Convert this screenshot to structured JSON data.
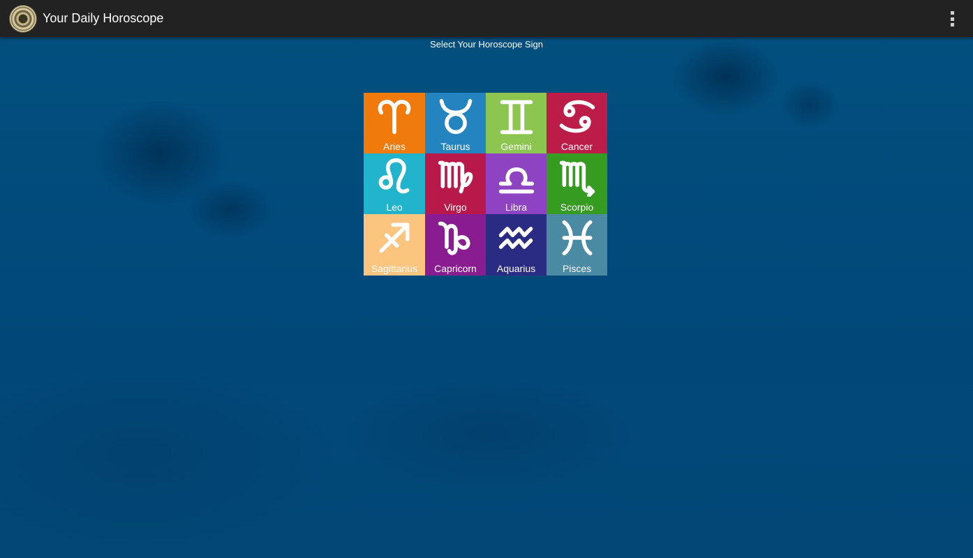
{
  "app": {
    "title": "Your Daily Horoscope",
    "icon": "zodiac-wheel-icon",
    "menu_icon": "overflow-menu-icon"
  },
  "page": {
    "subtitle": "Select Your Horoscope Sign"
  },
  "signs": [
    {
      "label": "Aries",
      "color": "#f07a0c",
      "icon": "aries-icon"
    },
    {
      "label": "Taurus",
      "color": "#2384c0",
      "icon": "taurus-icon"
    },
    {
      "label": "Gemini",
      "color": "#8cc651",
      "icon": "gemini-icon"
    },
    {
      "label": "Cancer",
      "color": "#bb1d48",
      "icon": "cancer-icon"
    },
    {
      "label": "Leo",
      "color": "#22b4cc",
      "icon": "leo-icon"
    },
    {
      "label": "Virgo",
      "color": "#b8194a",
      "icon": "virgo-icon"
    },
    {
      "label": "Libra",
      "color": "#8e44c2",
      "icon": "libra-icon"
    },
    {
      "label": "Scorpio",
      "color": "#359b21",
      "icon": "scorpio-icon"
    },
    {
      "label": "Sagittarius",
      "color": "#fcc57f",
      "icon": "sagittarius-icon"
    },
    {
      "label": "Capricorn",
      "color": "#8a1c91",
      "icon": "capricorn-icon"
    },
    {
      "label": "Aquarius",
      "color": "#2a2b82",
      "icon": "aquarius-icon"
    },
    {
      "label": "Pisces",
      "color": "#4a8aa3",
      "icon": "pisces-icon"
    }
  ]
}
